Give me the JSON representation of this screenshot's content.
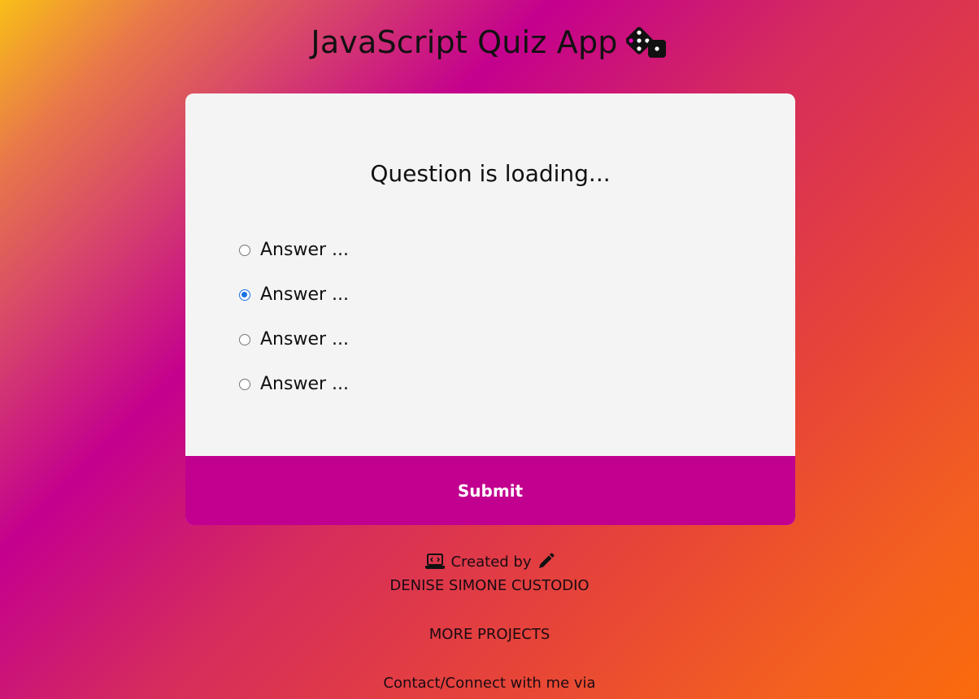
{
  "header": {
    "title": "JavaScript Quiz App",
    "icon": "dice-icon"
  },
  "quiz": {
    "question": "Question is loading...",
    "answers": [
      {
        "label": "Answer ...",
        "checked": false
      },
      {
        "label": "Answer ...",
        "checked": true
      },
      {
        "label": "Answer ...",
        "checked": false
      },
      {
        "label": "Answer ...",
        "checked": false
      }
    ],
    "submit_label": "Submit"
  },
  "footer": {
    "created_by": "Created by",
    "author": "DENISE SIMONE CUSTODIO",
    "more_projects": "MORE PROJECTS",
    "contact": "Contact/Connect with me via"
  },
  "colors": {
    "card_background": "#f4f4f4",
    "submit_button": "#c2008f",
    "radio_checked": "#1a73e8"
  }
}
